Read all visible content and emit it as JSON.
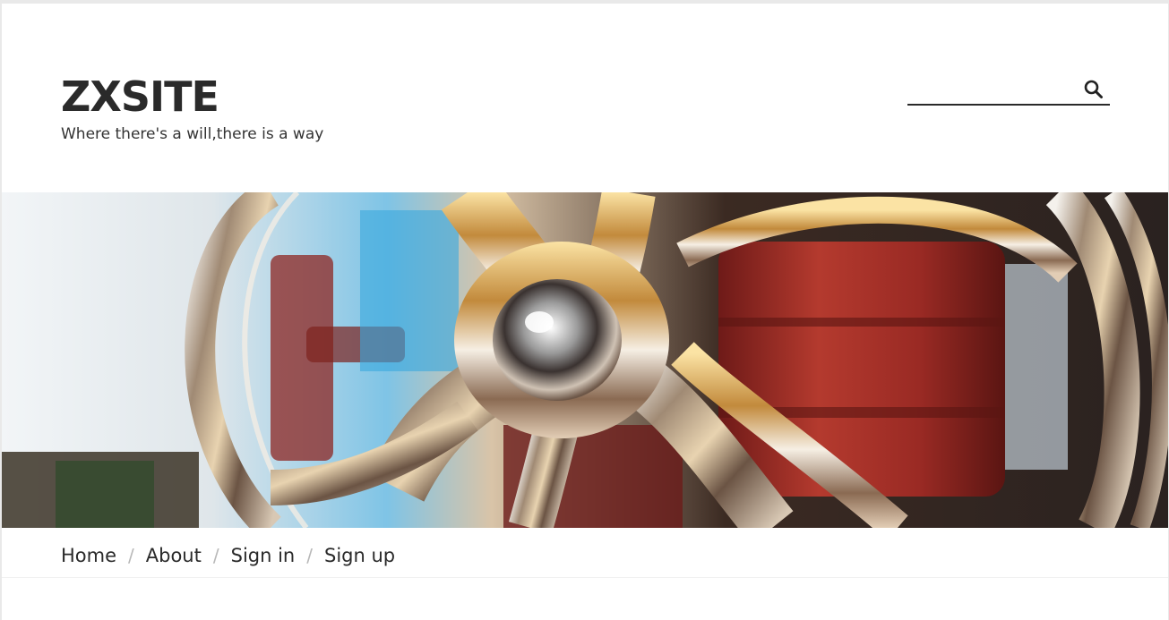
{
  "header": {
    "site_title": "ZXSITE",
    "tagline": "Where there's a will,there is a way"
  },
  "search": {
    "value": "",
    "placeholder": "",
    "icon": "search-icon"
  },
  "banner": {
    "image": "chrome-handwheel-photo"
  },
  "nav": {
    "separator": "/",
    "items": [
      {
        "label": "Home"
      },
      {
        "label": "About"
      },
      {
        "label": "Sign in"
      },
      {
        "label": "Sign up"
      }
    ]
  },
  "colors": {
    "text": "#2a2a2a",
    "separator": "#b8b8b8",
    "page_background": "#ffffff",
    "outer_background": "#e9e9e9"
  }
}
